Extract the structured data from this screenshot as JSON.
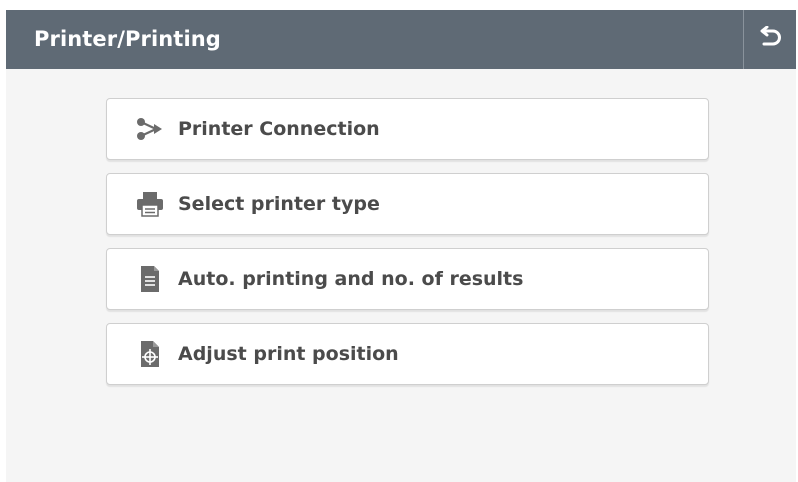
{
  "header": {
    "title": "Printer/Printing",
    "back_icon": "undo-arrow-icon"
  },
  "menu": {
    "items": [
      {
        "label": "Printer Connection",
        "icon": "connection-share-icon"
      },
      {
        "label": "Select printer type",
        "icon": "printer-icon"
      },
      {
        "label": "Auto. printing and no. of results",
        "icon": "document-list-icon"
      },
      {
        "label": "Adjust print position",
        "icon": "document-crosshair-icon"
      }
    ]
  },
  "colors": {
    "header_bg": "#5f6a75",
    "body_bg": "#f5f5f5",
    "item_text": "#4b4b4b",
    "icon": "#6b6b6b"
  }
}
